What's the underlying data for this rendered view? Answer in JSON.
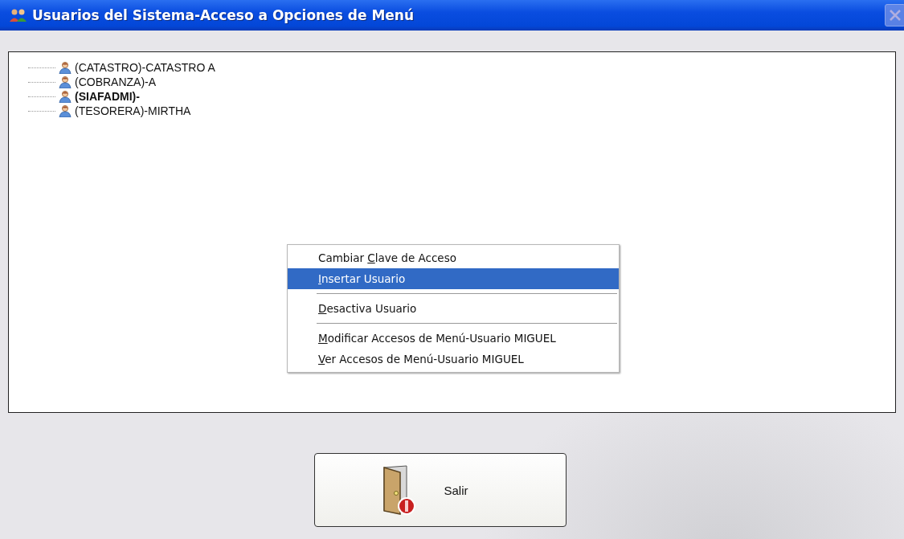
{
  "window": {
    "title": "Usuarios del Sistema-Acceso a Opciones de Menú",
    "close_disabled": true
  },
  "tree": {
    "items": [
      {
        "label": "(CATASTRO)-CATASTRO A",
        "current": false
      },
      {
        "label": "(COBRANZA)-A",
        "current": false
      },
      {
        "label": "(SIAFADMI)-",
        "current": true
      },
      {
        "label": "(TESORERA)-MIRTHA",
        "current": false
      }
    ]
  },
  "context_menu": {
    "items": [
      {
        "kind": "item",
        "label_parts": {
          "before": "Cambiar ",
          "key": "C",
          "after": "lave de Acceso"
        },
        "selected": false
      },
      {
        "kind": "item",
        "label_parts": {
          "key": "I",
          "after": "nsertar Usuario"
        },
        "selected": true
      },
      {
        "kind": "separator"
      },
      {
        "kind": "item",
        "label_parts": {
          "key": "D",
          "after": "esactiva Usuario"
        },
        "selected": false
      },
      {
        "kind": "separator"
      },
      {
        "kind": "item",
        "label_parts": {
          "key": "M",
          "after": "odificar Accesos de Menú-Usuario MIGUEL"
        },
        "selected": false
      },
      {
        "kind": "item",
        "label_parts": {
          "key": "V",
          "after": "er Accesos de Menú-Usuario MIGUEL"
        },
        "selected": false
      }
    ]
  },
  "exit_button": {
    "label": "Salir"
  }
}
